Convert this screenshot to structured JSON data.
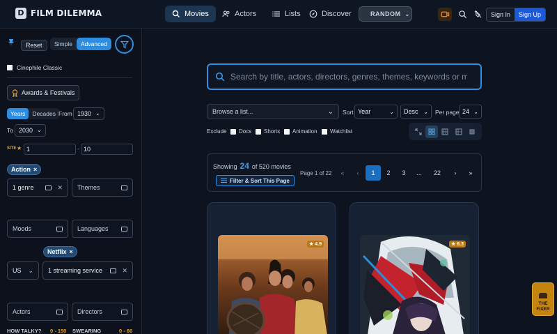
{
  "app": {
    "name": "FILM DILEMMA",
    "logo_letter": "D"
  },
  "nav": {
    "movies": "Movies",
    "actors": "Actors",
    "lists": "Lists",
    "discover": "Discover",
    "random": "RANDOM",
    "sign_in": "Sign In",
    "sign_up": "Sign Up"
  },
  "sidebar": {
    "reset": "Reset",
    "mode_simple": "Simple",
    "mode_advanced": "Advanced",
    "cinephile_classic": "Cinephile Classic",
    "awards_festivals": "Awards & Festivals",
    "years": "Years",
    "decades": "Decades",
    "from_label": "From",
    "from_value": "1930",
    "to_label": "To",
    "to_value": "2030",
    "site_label": "SITE",
    "site_min": "1",
    "site_sep": "-",
    "site_max": "10",
    "genre_tag": "Action",
    "genre_count": "1 genre",
    "themes": "Themes",
    "moods": "Moods",
    "languages": "Languages",
    "streaming_tag": "Netflix",
    "country": "US",
    "streaming_count": "1 streaming service",
    "actors": "Actors",
    "directors": "Directors",
    "talky_label": "HOW TALKY?",
    "talky_range": "0 - 150",
    "swearing_label": "SWEARING",
    "swearing_range": "0 - 60"
  },
  "main": {
    "search_placeholder": "Search by title, actors, directors, genres, themes, keywords or moods",
    "browse_list": "Browse a list...",
    "sort_label": "Sort",
    "sort_value": "Year",
    "order_value": "Desc",
    "per_page_label": "Per page",
    "per_page_value": "24",
    "exclude_label": "Exclude",
    "exclude_docs": "Docs",
    "exclude_shorts": "Shorts",
    "exclude_animation": "Animation",
    "exclude_watchlist": "Watchlist",
    "showing_prefix": "Showing",
    "showing_count": "24",
    "showing_suffix": "of 520 movies",
    "filter_sort_button": "Filter & Sort This Page",
    "page_of": "Page 1 of 22",
    "pages": [
      "1",
      "2",
      "3",
      "...",
      "22"
    ],
    "cards": [
      {
        "rating": "★ 4.9"
      },
      {
        "rating": "★ 6.3"
      }
    ]
  },
  "fixer": {
    "line1": "THE",
    "line2": "FIXER"
  },
  "colors": {
    "accent": "#2f8ee2",
    "background": "#0d1420",
    "rating": "#b7781a"
  }
}
